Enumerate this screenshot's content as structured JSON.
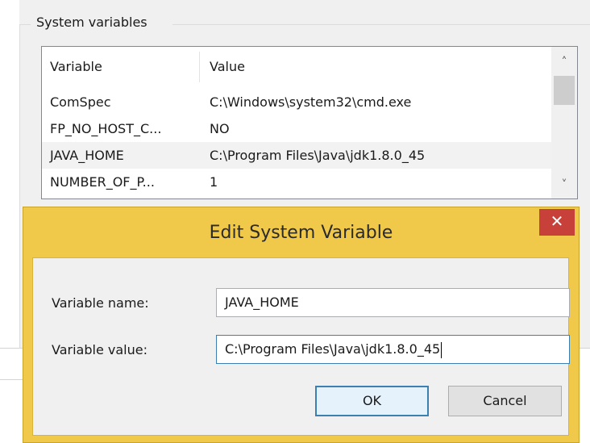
{
  "background": {
    "group_title": "System variables",
    "columns": [
      "Variable",
      "Value"
    ],
    "rows": [
      {
        "variable": "ComSpec",
        "value": "C:\\Windows\\system32\\cmd.exe"
      },
      {
        "variable": "FP_NO_HOST_C...",
        "value": "NO"
      },
      {
        "variable": "JAVA_HOME",
        "value": "C:\\Program Files\\Java\\jdk1.8.0_45"
      },
      {
        "variable": "NUMBER_OF_P...",
        "value": "1"
      }
    ],
    "selected_row": 2,
    "scroll_up_glyph": "˄",
    "scroll_down_glyph": "˅"
  },
  "dialog": {
    "title": "Edit System Variable",
    "close_glyph": "✕",
    "name_label": "Variable name:",
    "name_value": "JAVA_HOME",
    "value_label": "Variable value:",
    "value_value": "C:\\Program Files\\Java\\jdk1.8.0_45",
    "ok_label": "OK",
    "cancel_label": "Cancel"
  },
  "colors": {
    "dialog_frame": "#f0c84a",
    "close_button": "#c7413a",
    "focus_border": "#3c7fb1"
  }
}
